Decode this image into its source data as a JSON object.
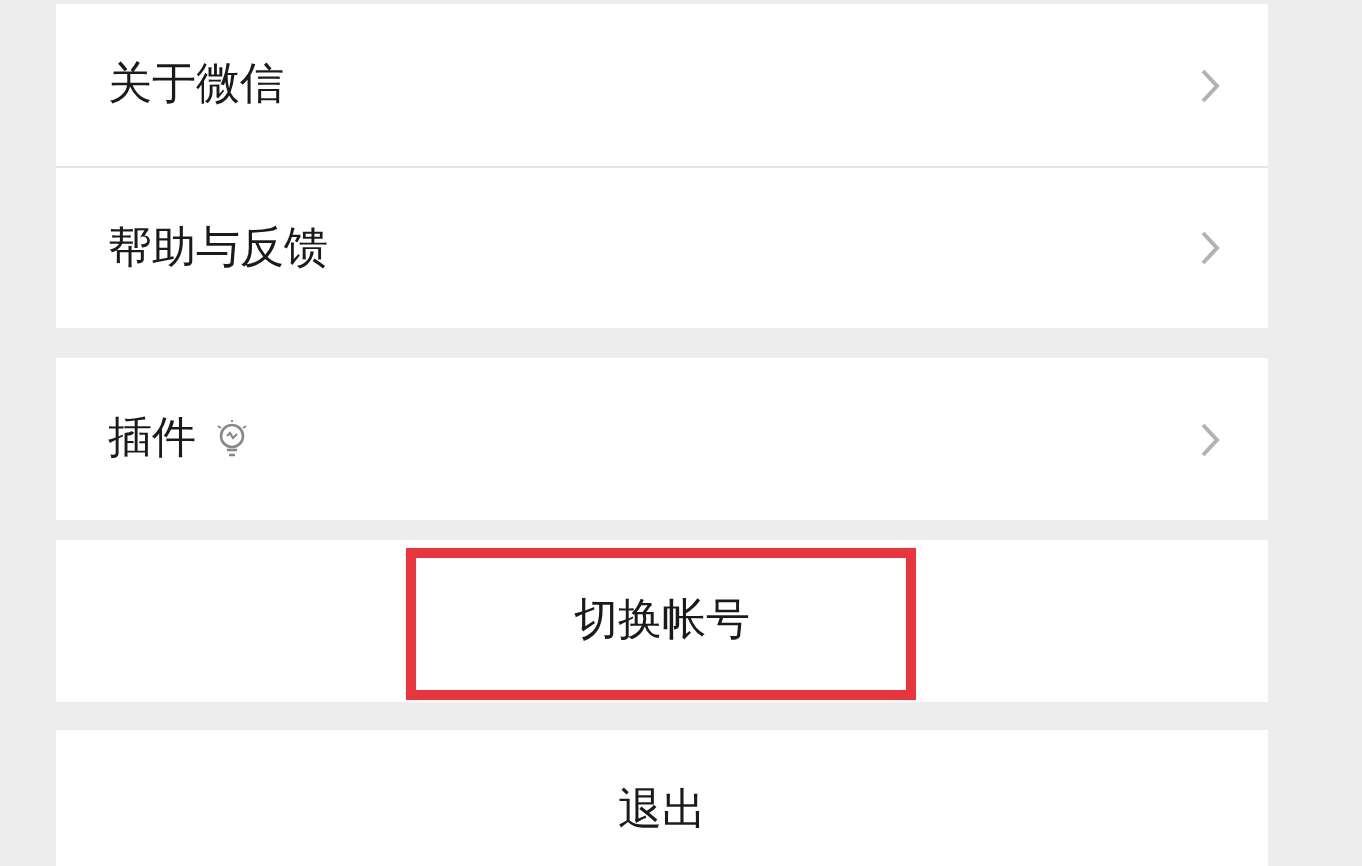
{
  "groups": [
    {
      "items": [
        {
          "label": "关于微信",
          "icon": false
        },
        {
          "label": "帮助与反馈",
          "icon": false
        }
      ]
    },
    {
      "items": [
        {
          "label": "插件",
          "icon": true
        }
      ]
    }
  ],
  "actions": [
    {
      "label": "切换帐号",
      "highlighted": true
    },
    {
      "label": "退出",
      "highlighted": false
    }
  ]
}
